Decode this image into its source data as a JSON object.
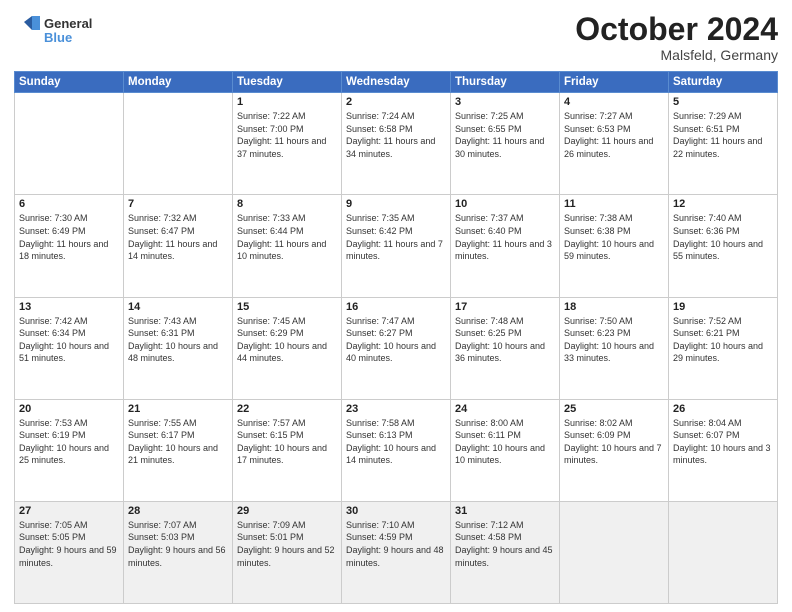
{
  "header": {
    "logo_line1": "General",
    "logo_line2": "Blue",
    "month": "October 2024",
    "location": "Malsfeld, Germany"
  },
  "weekdays": [
    "Sunday",
    "Monday",
    "Tuesday",
    "Wednesday",
    "Thursday",
    "Friday",
    "Saturday"
  ],
  "weeks": [
    [
      {
        "day": "",
        "info": ""
      },
      {
        "day": "",
        "info": ""
      },
      {
        "day": "1",
        "info": "Sunrise: 7:22 AM\nSunset: 7:00 PM\nDaylight: 11 hours\nand 37 minutes."
      },
      {
        "day": "2",
        "info": "Sunrise: 7:24 AM\nSunset: 6:58 PM\nDaylight: 11 hours\nand 34 minutes."
      },
      {
        "day": "3",
        "info": "Sunrise: 7:25 AM\nSunset: 6:55 PM\nDaylight: 11 hours\nand 30 minutes."
      },
      {
        "day": "4",
        "info": "Sunrise: 7:27 AM\nSunset: 6:53 PM\nDaylight: 11 hours\nand 26 minutes."
      },
      {
        "day": "5",
        "info": "Sunrise: 7:29 AM\nSunset: 6:51 PM\nDaylight: 11 hours\nand 22 minutes."
      }
    ],
    [
      {
        "day": "6",
        "info": "Sunrise: 7:30 AM\nSunset: 6:49 PM\nDaylight: 11 hours\nand 18 minutes."
      },
      {
        "day": "7",
        "info": "Sunrise: 7:32 AM\nSunset: 6:47 PM\nDaylight: 11 hours\nand 14 minutes."
      },
      {
        "day": "8",
        "info": "Sunrise: 7:33 AM\nSunset: 6:44 PM\nDaylight: 11 hours\nand 10 minutes."
      },
      {
        "day": "9",
        "info": "Sunrise: 7:35 AM\nSunset: 6:42 PM\nDaylight: 11 hours\nand 7 minutes."
      },
      {
        "day": "10",
        "info": "Sunrise: 7:37 AM\nSunset: 6:40 PM\nDaylight: 11 hours\nand 3 minutes."
      },
      {
        "day": "11",
        "info": "Sunrise: 7:38 AM\nSunset: 6:38 PM\nDaylight: 10 hours\nand 59 minutes."
      },
      {
        "day": "12",
        "info": "Sunrise: 7:40 AM\nSunset: 6:36 PM\nDaylight: 10 hours\nand 55 minutes."
      }
    ],
    [
      {
        "day": "13",
        "info": "Sunrise: 7:42 AM\nSunset: 6:34 PM\nDaylight: 10 hours\nand 51 minutes."
      },
      {
        "day": "14",
        "info": "Sunrise: 7:43 AM\nSunset: 6:31 PM\nDaylight: 10 hours\nand 48 minutes."
      },
      {
        "day": "15",
        "info": "Sunrise: 7:45 AM\nSunset: 6:29 PM\nDaylight: 10 hours\nand 44 minutes."
      },
      {
        "day": "16",
        "info": "Sunrise: 7:47 AM\nSunset: 6:27 PM\nDaylight: 10 hours\nand 40 minutes."
      },
      {
        "day": "17",
        "info": "Sunrise: 7:48 AM\nSunset: 6:25 PM\nDaylight: 10 hours\nand 36 minutes."
      },
      {
        "day": "18",
        "info": "Sunrise: 7:50 AM\nSunset: 6:23 PM\nDaylight: 10 hours\nand 33 minutes."
      },
      {
        "day": "19",
        "info": "Sunrise: 7:52 AM\nSunset: 6:21 PM\nDaylight: 10 hours\nand 29 minutes."
      }
    ],
    [
      {
        "day": "20",
        "info": "Sunrise: 7:53 AM\nSunset: 6:19 PM\nDaylight: 10 hours\nand 25 minutes."
      },
      {
        "day": "21",
        "info": "Sunrise: 7:55 AM\nSunset: 6:17 PM\nDaylight: 10 hours\nand 21 minutes."
      },
      {
        "day": "22",
        "info": "Sunrise: 7:57 AM\nSunset: 6:15 PM\nDaylight: 10 hours\nand 17 minutes."
      },
      {
        "day": "23",
        "info": "Sunrise: 7:58 AM\nSunset: 6:13 PM\nDaylight: 10 hours\nand 14 minutes."
      },
      {
        "day": "24",
        "info": "Sunrise: 8:00 AM\nSunset: 6:11 PM\nDaylight: 10 hours\nand 10 minutes."
      },
      {
        "day": "25",
        "info": "Sunrise: 8:02 AM\nSunset: 6:09 PM\nDaylight: 10 hours\nand 7 minutes."
      },
      {
        "day": "26",
        "info": "Sunrise: 8:04 AM\nSunset: 6:07 PM\nDaylight: 10 hours\nand 3 minutes."
      }
    ],
    [
      {
        "day": "27",
        "info": "Sunrise: 7:05 AM\nSunset: 5:05 PM\nDaylight: 9 hours\nand 59 minutes."
      },
      {
        "day": "28",
        "info": "Sunrise: 7:07 AM\nSunset: 5:03 PM\nDaylight: 9 hours\nand 56 minutes."
      },
      {
        "day": "29",
        "info": "Sunrise: 7:09 AM\nSunset: 5:01 PM\nDaylight: 9 hours\nand 52 minutes."
      },
      {
        "day": "30",
        "info": "Sunrise: 7:10 AM\nSunset: 4:59 PM\nDaylight: 9 hours\nand 48 minutes."
      },
      {
        "day": "31",
        "info": "Sunrise: 7:12 AM\nSunset: 4:58 PM\nDaylight: 9 hours\nand 45 minutes."
      },
      {
        "day": "",
        "info": ""
      },
      {
        "day": "",
        "info": ""
      }
    ]
  ]
}
